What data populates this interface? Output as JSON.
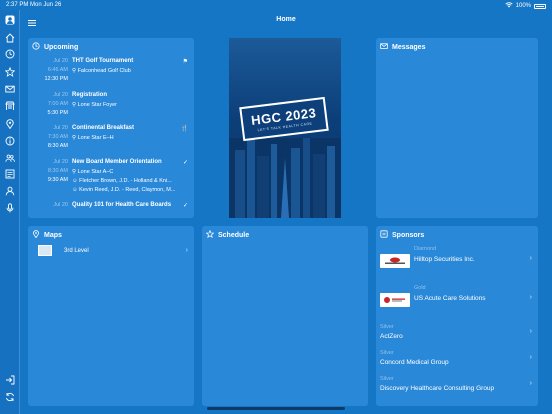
{
  "status_bar": {
    "time": "2:37 PM",
    "date": "Mon Jun 26",
    "battery": "100%"
  },
  "header": {
    "title": "Home"
  },
  "upcoming": {
    "title": "Upcoming",
    "events": [
      {
        "date": "Jul 20",
        "start": "6:46 AM",
        "end": "12:30 PM",
        "name": "THT Golf Tournament",
        "locations": [
          "Falconhead Golf Club"
        ],
        "marker": "flag"
      },
      {
        "date": "Jul 20",
        "start": "7:00 AM",
        "end": "5:30 PM",
        "name": "Registration",
        "locations": [
          "Lone Star Foyer"
        ],
        "marker": ""
      },
      {
        "date": "Jul 20",
        "start": "7:30 AM",
        "end": "8:30 AM",
        "name": "Continental Breakfast",
        "locations": [
          "Lone Star E–H"
        ],
        "marker": "fork-knife"
      },
      {
        "date": "Jul 20",
        "start": "8:30 AM",
        "end": "9:30 AM",
        "name": "New Board Member Orientation",
        "locations": [
          "Lone Star A–C",
          "Fletcher Brown, J.D. - Holland & Kni...",
          "Kevin Reed, J.D. - Reed, Claymon, M..."
        ],
        "marker": "check"
      },
      {
        "date": "Jul 20",
        "start": "",
        "end": "",
        "name": "Quality 101 for Health Care Boards",
        "locations": [],
        "marker": "check"
      }
    ]
  },
  "hero": {
    "logo_text": "HGC 2023",
    "logo_sub": "LET'S TALK HEALTH CARE"
  },
  "messages": {
    "title": "Messages"
  },
  "maps": {
    "title": "Maps",
    "items": [
      {
        "label": "3rd Level"
      }
    ]
  },
  "schedule": {
    "title": "Schedule"
  },
  "sponsors": {
    "title": "Sponsors",
    "items": [
      {
        "tier": "Diamond",
        "name": "Hilltop Securities Inc.",
        "has_logo": true
      },
      {
        "tier": "Gold",
        "name": "US Acute Care Solutions",
        "has_logo": true
      },
      {
        "tier": "Silver",
        "name": "ActZero",
        "has_logo": false
      },
      {
        "tier": "Silver",
        "name": "Concord Medical Group",
        "has_logo": false
      },
      {
        "tier": "Silver",
        "name": "Discovery Healthcare Consulting Group",
        "has_logo": false
      }
    ]
  },
  "sidebar": {
    "icons": [
      "avatar-icon",
      "home-icon",
      "clock-icon",
      "star-icon",
      "mail-icon",
      "exhibitor-icon",
      "map-pin-icon",
      "info-icon",
      "people-icon",
      "survey-icon",
      "person-icon",
      "microphone-icon",
      "logout-icon",
      "sync-icon"
    ]
  },
  "colors": {
    "background": "#1676c6",
    "card": "#2a88d8",
    "hero": "#0d3f7b"
  }
}
